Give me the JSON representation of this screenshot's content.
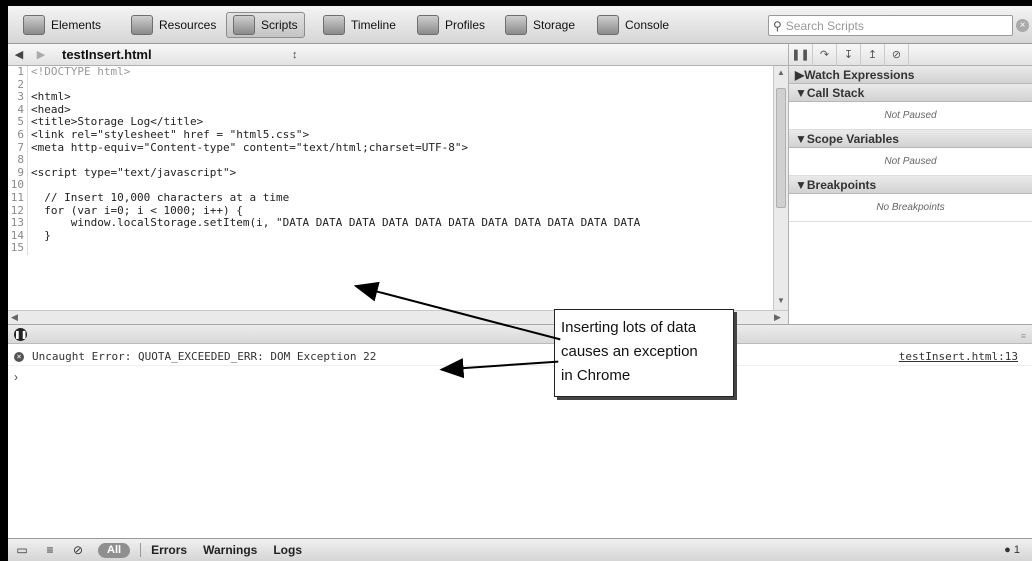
{
  "toolbar": {
    "tabs": [
      {
        "label": "Elements",
        "icon": "elements-icon"
      },
      {
        "label": "Resources",
        "icon": "resources-icon"
      },
      {
        "label": "Scripts",
        "icon": "scripts-icon",
        "active": true
      },
      {
        "label": "Timeline",
        "icon": "timeline-icon"
      },
      {
        "label": "Profiles",
        "icon": "profiles-icon"
      },
      {
        "label": "Storage",
        "icon": "storage-icon"
      },
      {
        "label": "Console",
        "icon": "console-icon"
      }
    ],
    "search_placeholder": "Search Scripts"
  },
  "file": {
    "title": "testInsert.html",
    "selector_glyph": "↕"
  },
  "code_lines": [
    {
      "n": "1",
      "text": "<!DOCTYPE html>",
      "doctype": true
    },
    {
      "n": "2",
      "text": ""
    },
    {
      "n": "3",
      "text": "<html>"
    },
    {
      "n": "4",
      "text": "<head>"
    },
    {
      "n": "5",
      "text": "<title>Storage Log</title>"
    },
    {
      "n": "6",
      "text": "<link rel=\"stylesheet\" href = \"html5.css\">"
    },
    {
      "n": "7",
      "text": "<meta http-equiv=\"Content-type\" content=\"text/html;charset=UTF-8\">"
    },
    {
      "n": "8",
      "text": ""
    },
    {
      "n": "9",
      "text": "<script type=\"text/javascript\">"
    },
    {
      "n": "10",
      "text": ""
    },
    {
      "n": "11",
      "text": "  // Insert 10,000 characters at a time"
    },
    {
      "n": "12",
      "text": "  for (var i=0; i < 1000; i++) {"
    },
    {
      "n": "13",
      "text": "      window.localStorage.setItem(i, \"DATA DATA DATA DATA DATA DATA DATA DATA DATA DATA DATA"
    },
    {
      "n": "14",
      "text": "  }"
    },
    {
      "n": "15",
      "text": ""
    }
  ],
  "sidebar": {
    "sections": [
      {
        "title": "▶Watch Expressions",
        "body": ""
      },
      {
        "title": "▼Call Stack",
        "body": "Not Paused"
      },
      {
        "title": "▼Scope Variables",
        "body": "Not Paused"
      },
      {
        "title": "▼Breakpoints",
        "body": "No Breakpoints"
      }
    ]
  },
  "console": {
    "error_text": "Uncaught Error: QUOTA_EXCEEDED_ERR: DOM Exception 22",
    "error_link": "testInsert.html:13",
    "prompt": "›"
  },
  "statusbar": {
    "all_label": "All",
    "filters": [
      "Errors",
      "Warnings",
      "Logs"
    ],
    "error_count": "1"
  },
  "annotation": {
    "lines": [
      "Inserting lots of data",
      "causes an exception",
      "in Chrome"
    ]
  }
}
